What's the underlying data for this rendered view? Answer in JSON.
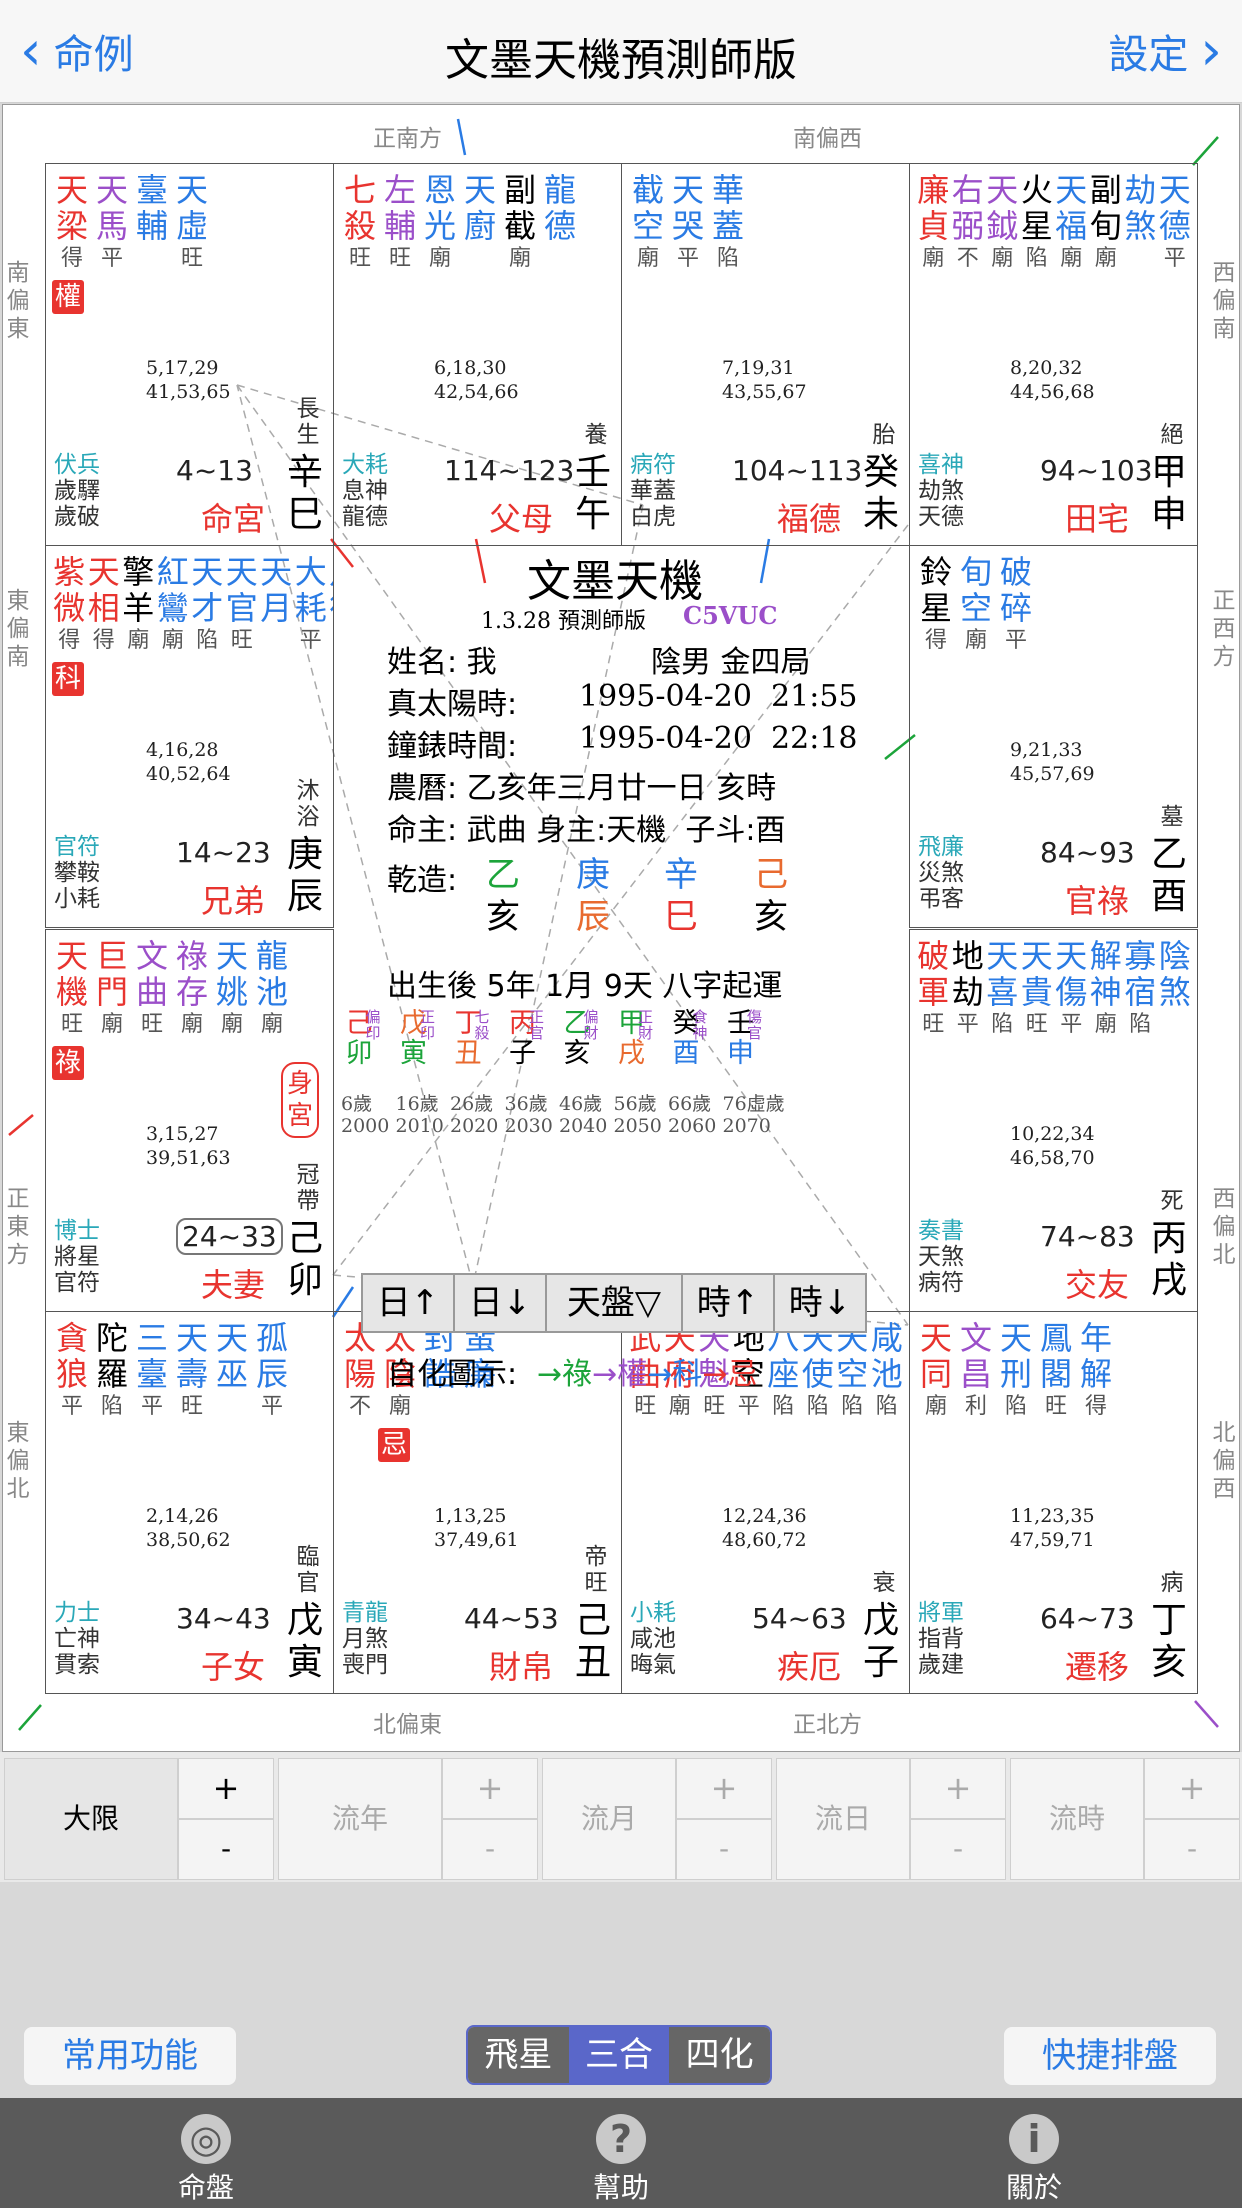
{
  "nav": {
    "back_label": "命例",
    "title": "文墨天機預測師版",
    "settings_label": "設定"
  },
  "directions": {
    "top_left": "正南方",
    "top_right": "南偏西",
    "bottom_left": "北偏東",
    "bottom_right": "正北方",
    "left_1": "南偏東",
    "left_2": "東偏南",
    "left_3": "正東方",
    "left_4": "東偏北",
    "right_1": "西偏南",
    "right_2": "正西方",
    "right_3": "西偏北",
    "right_4": "北偏西"
  },
  "palaces": [
    {
      "id": "si",
      "stars": [
        [
          "天梁",
          "cr",
          "得"
        ],
        [
          "天馬",
          "cp",
          "平"
        ],
        [
          "臺輔",
          "cb2",
          ""
        ],
        [
          "天虛",
          "cb2",
          "旺"
        ]
      ],
      "badge": "權",
      "ages": [
        "5,17,29",
        "41,53,65"
      ],
      "cycle": "長生",
      "gods": [
        "伏兵",
        "歲驛",
        "歲破"
      ],
      "range": "4~13",
      "name": "命宮",
      "stem": "辛巳"
    },
    {
      "id": "wu",
      "stars": [
        [
          "七殺",
          "cr",
          "旺"
        ],
        [
          "左輔",
          "cp",
          "旺"
        ],
        [
          "恩光",
          "cb2",
          "廟"
        ],
        [
          "天廚",
          "cb2",
          ""
        ],
        [
          "副截",
          "ck",
          "廟"
        ],
        [
          "龍德",
          "cb2",
          ""
        ]
      ],
      "badge": "",
      "ages": [
        "6,18,30",
        "42,54,66"
      ],
      "cycle": "養",
      "gods": [
        "大耗",
        "息神",
        "龍德"
      ],
      "range": "114~123",
      "name": "父母",
      "stem": "壬午"
    },
    {
      "id": "wei",
      "stars": [
        [
          "截空",
          "cb2",
          "廟"
        ],
        [
          "天哭",
          "cb2",
          "平"
        ],
        [
          "華蓋",
          "cb2",
          "陷"
        ]
      ],
      "badge": "",
      "ages": [
        "7,19,31",
        "43,55,67"
      ],
      "cycle": "胎",
      "gods": [
        "病符",
        "華蓋",
        "白虎"
      ],
      "range": "104~113",
      "name": "福德",
      "stem": "癸未"
    },
    {
      "id": "shen",
      "stars": [
        [
          "廉貞",
          "cr",
          "廟"
        ],
        [
          "右弼",
          "cp",
          "不"
        ],
        [
          "天鉞",
          "cp",
          "廟"
        ],
        [
          "火星",
          "ck",
          "陷"
        ],
        [
          "天福",
          "cb2",
          "廟"
        ],
        [
          "副旬",
          "ck",
          "廟"
        ],
        [
          "劫煞",
          "cb2",
          ""
        ],
        [
          "天德",
          "cb2",
          "平"
        ]
      ],
      "badge": "",
      "ages": [
        "8,20,32",
        "44,56,68"
      ],
      "cycle": "絕",
      "gods": [
        "喜神",
        "劫煞",
        "天德"
      ],
      "range": "94~103",
      "name": "田宅",
      "stem": "甲申"
    },
    {
      "id": "chen",
      "stars": [
        [
          "紫微",
          "cr",
          "得"
        ],
        [
          "天相",
          "cr",
          "得"
        ],
        [
          "擎羊",
          "ck",
          "廟"
        ],
        [
          "紅鸞",
          "cb2",
          "廟"
        ],
        [
          "天才",
          "cb2",
          "陷"
        ],
        [
          "天官",
          "cb2",
          "旺"
        ],
        [
          "天月",
          "cb2",
          ""
        ],
        [
          "大耗",
          "cb2",
          "平"
        ],
        [
          "月德",
          "cb2",
          ""
        ]
      ],
      "badge": "科",
      "ages": [
        "4,16,28",
        "40,52,64"
      ],
      "cycle": "沐浴",
      "gods": [
        "官符",
        "攀鞍",
        "小耗"
      ],
      "range": "14~23",
      "name": "兄弟",
      "stem": "庚辰"
    },
    {
      "id": "you",
      "stars": [
        [
          "鈴星",
          "ck",
          "得"
        ],
        [
          "旬空",
          "cb2",
          "廟"
        ],
        [
          "破碎",
          "cb2",
          "平"
        ]
      ],
      "badge": "",
      "ages": [
        "9,21,33",
        "45,57,69"
      ],
      "cycle": "墓",
      "gods": [
        "飛廉",
        "災煞",
        "弔客"
      ],
      "range": "84~93",
      "name": "官祿",
      "stem": "乙酉"
    },
    {
      "id": "mao",
      "stars": [
        [
          "天機",
          "cr",
          "旺"
        ],
        [
          "巨門",
          "cr",
          "廟"
        ],
        [
          "文曲",
          "cp",
          "旺"
        ],
        [
          "祿存",
          "cp",
          "廟"
        ],
        [
          "天姚",
          "cb2",
          "廟"
        ],
        [
          "龍池",
          "cb2",
          "廟"
        ]
      ],
      "badge": "祿",
      "ages": [
        "3,15,27",
        "39,51,63"
      ],
      "cycle": "冠帶",
      "gods": [
        "博士",
        "將星",
        "官符"
      ],
      "range": "24~33",
      "name": "夫妻",
      "stem": "己卯",
      "body": "身宮"
    },
    {
      "id": "xu",
      "stars": [
        [
          "破軍",
          "cr",
          "旺"
        ],
        [
          "地劫",
          "ck",
          "平"
        ],
        [
          "天喜",
          "cb2",
          "陷"
        ],
        [
          "天貴",
          "cb2",
          "旺"
        ],
        [
          "天傷",
          "cb2",
          "平"
        ],
        [
          "解神",
          "cb2",
          "廟"
        ],
        [
          "寡宿",
          "cb2",
          "陷"
        ],
        [
          "陰煞",
          "cb2",
          ""
        ]
      ],
      "badge": "",
      "ages": [
        "10,22,34",
        "46,58,70"
      ],
      "cycle": "死",
      "gods": [
        "奏書",
        "天煞",
        "病符"
      ],
      "range": "74~83",
      "name": "交友",
      "stem": "丙戌"
    },
    {
      "id": "yin",
      "stars": [
        [
          "貪狼",
          "cr",
          "平"
        ],
        [
          "陀羅",
          "ck",
          "陷"
        ],
        [
          "三臺",
          "cb2",
          "平"
        ],
        [
          "天壽",
          "cb2",
          "旺"
        ],
        [
          "天巫",
          "cb2",
          ""
        ],
        [
          "孤辰",
          "cb2",
          "平"
        ]
      ],
      "badge": "",
      "ages": [
        "2,14,26",
        "38,50,62"
      ],
      "cycle": "臨官",
      "gods": [
        "力士",
        "亡神",
        "貫索"
      ],
      "range": "34~43",
      "name": "子女",
      "stem": "戊寅"
    },
    {
      "id": "chou",
      "stars": [
        [
          "太陽",
          "cr",
          "不"
        ],
        [
          "太陰",
          "cr",
          "廟"
        ],
        [
          "封誥",
          "cb2",
          ""
        ],
        [
          "蜚廉",
          "cb2",
          ""
        ]
      ],
      "badge": "",
      "badge2": "忌",
      "ages": [
        "1,13,25",
        "37,49,61"
      ],
      "cycle": "帝旺",
      "gods": [
        "青龍",
        "月煞",
        "喪門"
      ],
      "range": "44~53",
      "name": "財帛",
      "stem": "己丑"
    },
    {
      "id": "zi",
      "stars": [
        [
          "武曲",
          "cr",
          "旺"
        ],
        [
          "天府",
          "cr",
          "廟"
        ],
        [
          "天魁",
          "cp",
          "旺"
        ],
        [
          "地空",
          "ck",
          "平"
        ],
        [
          "八座",
          "cb2",
          "陷"
        ],
        [
          "天使",
          "cb2",
          "陷"
        ],
        [
          "天空",
          "cb2",
          "陷"
        ],
        [
          "咸池",
          "cb2",
          "陷"
        ]
      ],
      "badge": "",
      "ages": [
        "12,24,36",
        "48,60,72"
      ],
      "cycle": "衰",
      "gods": [
        "小耗",
        "咸池",
        "晦氣"
      ],
      "range": "54~63",
      "name": "疾厄",
      "stem": "戊子"
    },
    {
      "id": "hai",
      "stars": [
        [
          "天同",
          "cr",
          "廟"
        ],
        [
          "文昌",
          "cp",
          "利"
        ],
        [
          "天刑",
          "cb2",
          "陷"
        ],
        [
          "鳳閣",
          "cb2",
          "旺"
        ],
        [
          "年解",
          "cb2",
          "得"
        ]
      ],
      "badge": "",
      "ages": [
        "11,23,35",
        "47,59,71"
      ],
      "cycle": "病",
      "gods": [
        "將軍",
        "指背",
        "歲建"
      ],
      "range": "64~73",
      "name": "遷移",
      "stem": "丁亥"
    }
  ],
  "center": {
    "brand": "文墨天機",
    "version": "1.3.28 預測師版",
    "code": "C5VUC",
    "name_line": "姓名: 我",
    "gender_line": "陰男 金四局",
    "solar_label": "真太陽時:",
    "solar_value": "1995-04-20  21:55",
    "clock_label": "鐘錶時間:",
    "clock_value": "1995-04-20  22:18",
    "lunar_line": "農曆: 乙亥年三月廿一日 亥時",
    "master_line": "命主: 武曲 身主:天機  子斗:酉",
    "qian_label": "乾造:",
    "pillars": [
      [
        "乙",
        "亥",
        "cg",
        "ck"
      ],
      [
        "庚",
        "辰",
        "cb2",
        "co"
      ],
      [
        "辛",
        "巳",
        "cb2",
        "cr"
      ],
      [
        "己",
        "亥",
        "co",
        "ck"
      ]
    ],
    "start_line": "出生後 5年 1月 9天 八字起運",
    "luck": [
      [
        "己",
        "卯",
        "偏印",
        "cr",
        "cg",
        "6歲",
        "2000"
      ],
      [
        "戊",
        "寅",
        "正印",
        "co",
        "cg",
        "16歲",
        "2010"
      ],
      [
        "丁",
        "丑",
        "七殺",
        "cr",
        "co",
        "26歲",
        "2020"
      ],
      [
        "丙",
        "子",
        "正官",
        "cr",
        "ck",
        "36歲",
        "2030"
      ],
      [
        "乙",
        "亥",
        "偏財",
        "cg",
        "ck",
        "46歲",
        "2040"
      ],
      [
        "甲",
        "戌",
        "正財",
        "cg",
        "co",
        "56歲",
        "2050"
      ],
      [
        "癸",
        "酉",
        "食神",
        "ck",
        "cb2",
        "66歲",
        "2060"
      ],
      [
        "壬",
        "申",
        "傷官",
        "ck",
        "cb2",
        "76虛歲",
        "2070"
      ]
    ],
    "buttons": [
      "日↑",
      "日↓",
      "天盤▽",
      "時↑",
      "時↓"
    ],
    "legend_label": "自化圖示:",
    "legend": [
      [
        "→祿",
        "cg"
      ],
      [
        "→權",
        "cp"
      ],
      [
        "→科",
        "cb2"
      ],
      [
        "→忌",
        "cr"
      ]
    ]
  },
  "controls": {
    "daxian": "大限",
    "liunian": "流年",
    "liuyue": "流月",
    "liuri": "流日",
    "liushi": "流時",
    "plus": "+",
    "minus": "-"
  },
  "bottom": {
    "common": "常用功能",
    "seg": [
      "飛星",
      "三合",
      "四化"
    ],
    "seg_active": 1,
    "quick": "快捷排盤"
  },
  "tabs": [
    {
      "label": "命盤",
      "icon": "◎"
    },
    {
      "label": "幫助",
      "icon": "?"
    },
    {
      "label": "關於",
      "icon": "i"
    }
  ]
}
